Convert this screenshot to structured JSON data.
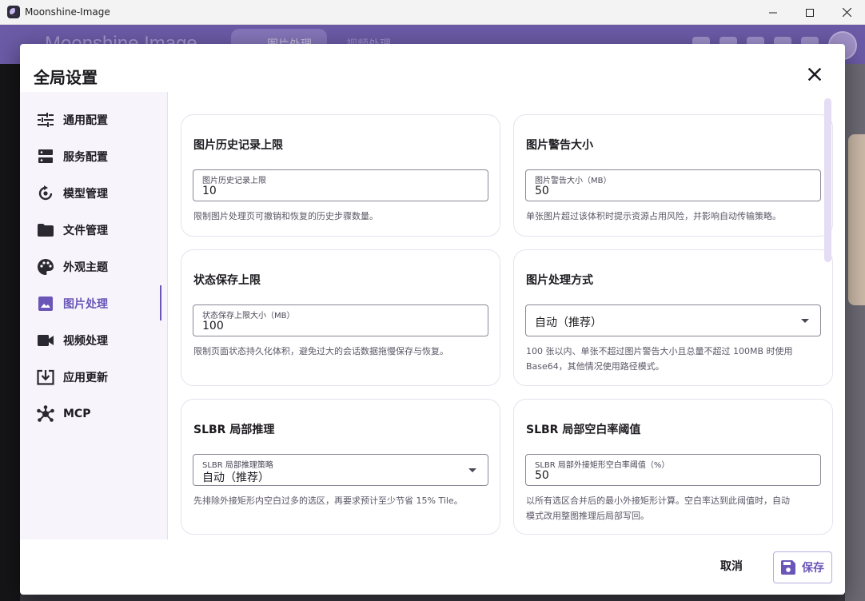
{
  "window": {
    "title": "Moonshine-Image"
  },
  "app_header": {
    "brand": "Moonshine Image",
    "tabs": [
      "图片处理",
      "视频处理"
    ]
  },
  "dialog": {
    "title": "全局设置",
    "cancel_label": "取消",
    "save_label": "保存"
  },
  "nav": {
    "items": [
      {
        "label": "通用配置",
        "icon": "tune-icon"
      },
      {
        "label": "服务配置",
        "icon": "server-icon"
      },
      {
        "label": "模型管理",
        "icon": "model-sync-icon"
      },
      {
        "label": "文件管理",
        "icon": "folder-icon"
      },
      {
        "label": "外观主题",
        "icon": "palette-icon"
      },
      {
        "label": "图片处理",
        "icon": "image-icon",
        "active": true
      },
      {
        "label": "视频处理",
        "icon": "videocam-icon"
      },
      {
        "label": "应用更新",
        "icon": "download-box-icon"
      },
      {
        "label": "MCP",
        "icon": "hub-icon"
      }
    ]
  },
  "cards": {
    "history": {
      "title": "图片历史记录上限",
      "field_label": "图片历史记录上限",
      "value": "10",
      "desc": "限制图片处理页可撤销和恢复的历史步骤数量。"
    },
    "warn_size": {
      "title": "图片警告大小",
      "field_label": "图片警告大小（MB）",
      "value": "50",
      "desc": "单张图片超过该体积时提示资源占用风险，并影响自动传输策略。"
    },
    "state_save": {
      "title": "状态保存上限",
      "field_label": "状态保存上限大小（MB）",
      "value": "100",
      "desc": "限制页面状态持久化体积，避免过大的会话数据拖慢保存与恢复。"
    },
    "process_mode": {
      "title": "图片处理方式",
      "value": "自动（推荐）",
      "desc_line1": "100 张以内、单张不超过图片警告大小且总量不超过 100MB 时使用",
      "desc_line2": "Base64，其他情况使用路径模式。"
    },
    "slbr_infer": {
      "title": "SLBR 局部推理",
      "field_label": "SLBR 局部推理策略",
      "value": "自动（推荐）",
      "desc": "先排除外接矩形内空白过多的选区，再要求预计至少节省 15% Tile。"
    },
    "slbr_threshold": {
      "title": "SLBR 局部空白率阈值",
      "field_label": "SLBR 局部外接矩形空白率阈值（%）",
      "value": "50",
      "desc_line1": "以所有选区合并后的最小外接矩形计算。空白率达到此阈值时，自动",
      "desc_line2": "模式改用整图推理后局部写回。"
    }
  },
  "colors": {
    "accent": "#6b56b8",
    "header": "#6b5aa6",
    "nav_bg": "#f7f5fb"
  }
}
